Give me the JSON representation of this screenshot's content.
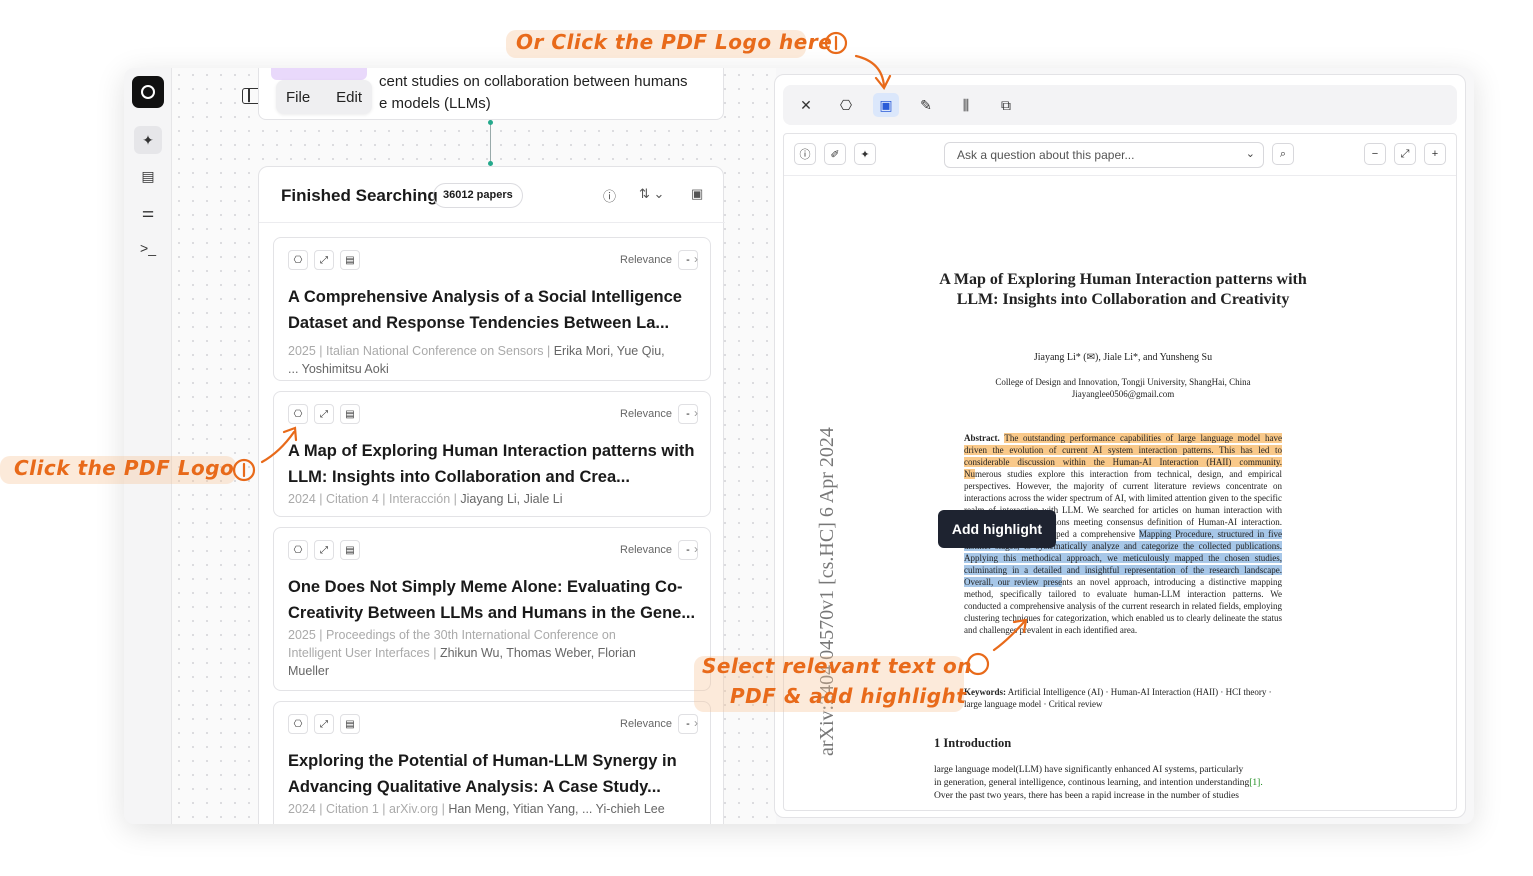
{
  "annotations": {
    "top": "Or Click the PDF Logo here",
    "left": "Click the PDF Logo",
    "right_line1": "Select relevant text on",
    "right_line2": "PDF & add highlight"
  },
  "menu": {
    "file": "File",
    "edit": "Edit"
  },
  "snippet": {
    "line1": "cent studies on collaboration between humans",
    "line2": "e models (LLMs)"
  },
  "results": {
    "title": "Finished Searching",
    "count": "36012 papers",
    "cards": [
      {
        "relevance": "Relevance",
        "score": "-",
        "title": "A Comprehensive Analysis of a Social Intelligence Dataset and Response Tendencies Between La...",
        "year": "2025",
        "venue": "Italian National Conference on Sensors",
        "authors": "Erika Mori, Yue Qiu,",
        "authors2": "... Yoshimitsu Aoki"
      },
      {
        "relevance": "Relevance",
        "score": "-",
        "title": "A Map of Exploring Human Interaction patterns with LLM: Insights into Collaboration and Crea...",
        "year": "2024",
        "venue": "Citation 4",
        "venue2": "Interacción",
        "authors": "Jiayang Li, Jiale Li"
      },
      {
        "relevance": "Relevance",
        "score": "-",
        "title": "One Does Not Simply Meme Alone: Evaluating Co-Creativity Between LLMs and Humans in the Gene...",
        "year": "2025",
        "venue": "Proceedings of the 30th International Conference on",
        "venue2": "Intelligent User Interfaces",
        "authors": "Zhikun Wu, Thomas Weber, Florian",
        "authors2": "Mueller"
      },
      {
        "relevance": "Relevance",
        "score": "-",
        "title": "Exploring the Potential of Human-LLM Synergy in Advancing Qualitative Analysis: A Case Study...",
        "year": "2024",
        "venue": "Citation 1",
        "venue2": "arXiv.org",
        "authors": "Han Meng, Yitian Yang, ... Yi-chieh Lee"
      }
    ]
  },
  "pdf": {
    "ask_placeholder": "Ask a question about this paper...",
    "arxiv": "arXiv:2404.04570v1  [cs.HC]  6 Apr 2024",
    "title": "A Map of Exploring Human Interaction patterns with LLM: Insights into Collaboration and Creativity",
    "authors": "Jiayang Li* (✉), Jiale Li*, and Yunsheng Su",
    "affiliation": "College of Design and Innovation, Tongji University, ShangHai, China",
    "email": "Jiayanglee0506@gmail.com",
    "abstract_label": "Abstract.",
    "abstract_hl1": "The outstanding performance capabilities of large language model have driven the evolution of current AI system interaction patterns. This has led to considerable discussion within the Human-AI Interaction (HAII) community. Nu",
    "abstract_mid": "merous studies explore this interaction from technical, design, and empirical perspectives. However, the majority of current literature reviews concentrate on interactions across the wider spectrum of AI, with limited attention given to the specific realm of interaction with LLM. We searched for articles on human interaction with LLM, selecting publications meeting consensus definition of Human-AI interaction. Subsequently, we developed a comprehensive ",
    "abstract_hl2": "Mapping Procedure, structured in five distinct stages, to systematically analyze and categorize the collected publications. Applying this methodical approach, we meticulously mapped the chosen studies, culminating in a detailed and insightful representation of the research landscape. Overall, our review prese",
    "abstract_end": "nts an novel approach, introducing a distinctive mapping method, specifically tailored to evaluate human-LLM interaction patterns. We conducted a comprehensive analysis of the current research in related fields, employing clustering techniques for categorization, which enabled us to clearly delineate the status and challenges prevalent in each identified area.",
    "keywords_label": "Keywords:",
    "keywords": "Artificial Intelligence (AI) · Human-AI Interaction (HAII) · HCI theory · large language model · Critical review",
    "section": "1   Introduction",
    "intro1": "large language model(LLM) have significantly enhanced AI systems, particularly",
    "intro2": "in generation, general intelligence, continous learning, and intention understanding",
    "intro_ref": "[1].",
    "intro3": "Over the past two years, there has been a rapid increase in the number of studies",
    "tooltip": "Add highlight"
  },
  "colors": {
    "accent": "#e86a1a",
    "highlight_orange": "#f9c98a",
    "highlight_blue": "#a7c7e8",
    "active_tool": "#dbe7fb"
  }
}
